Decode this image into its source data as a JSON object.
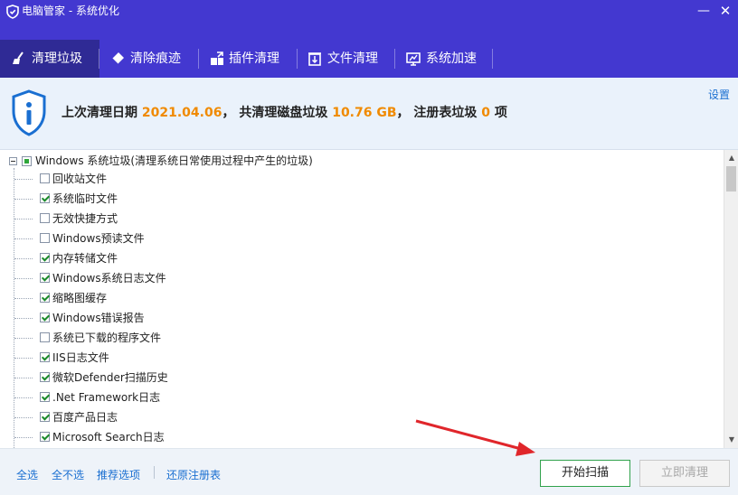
{
  "window": {
    "title": "电脑管家 - 系统优化",
    "minimize_glyph": "—",
    "close_glyph": "✕"
  },
  "tabs": [
    {
      "label": "清理垃圾",
      "icon": "broom-icon",
      "active": true
    },
    {
      "label": "清除痕迹",
      "icon": "eraser-icon",
      "active": false
    },
    {
      "label": "插件清理",
      "icon": "plugin-icon",
      "active": false
    },
    {
      "label": "文件清理",
      "icon": "file-clean-icon",
      "active": false
    },
    {
      "label": "系统加速",
      "icon": "monitor-speed-icon",
      "active": false
    }
  ],
  "info": {
    "last_clean_label": "上次清理日期",
    "last_clean_date": "2021.04.06",
    "sep1": "，",
    "disk_label": "共清理磁盘垃圾",
    "disk_size": "10.76 GB",
    "sep2": "，",
    "registry_label": "注册表垃圾",
    "registry_count": "0",
    "registry_unit": "项",
    "settings_label": "设置"
  },
  "tree": {
    "root_label": "Windows 系统垃圾(清理系统日常使用过程中产生的垃圾)",
    "root_state": "partial",
    "items": [
      {
        "label": "回收站文件",
        "checked": false
      },
      {
        "label": "系统临时文件",
        "checked": true
      },
      {
        "label": "无效快捷方式",
        "checked": false
      },
      {
        "label": "Windows预读文件",
        "checked": false
      },
      {
        "label": "内存转储文件",
        "checked": true
      },
      {
        "label": "Windows系统日志文件",
        "checked": true
      },
      {
        "label": "缩略图缓存",
        "checked": true
      },
      {
        "label": "Windows错误报告",
        "checked": true
      },
      {
        "label": "系统已下载的程序文件",
        "checked": false
      },
      {
        "label": "IIS日志文件",
        "checked": true
      },
      {
        "label": "微软Defender扫描历史",
        "checked": true
      },
      {
        "label": ".Net Framework日志",
        "checked": true
      },
      {
        "label": "百度产品日志",
        "checked": true
      },
      {
        "label": "Microsoft Search日志",
        "checked": true
      }
    ]
  },
  "footer": {
    "select_all": "全选",
    "select_none": "全不选",
    "recommended": "推荐选项",
    "restore_registry": "还原注册表",
    "scan_button": "开始扫描",
    "clean_button": "立即清理"
  },
  "colors": {
    "brand": "#4338d0",
    "active_tab": "#2f2a95",
    "highlight": "#f08a00",
    "link": "#1a6fd1",
    "scan_border": "#31a24c"
  }
}
